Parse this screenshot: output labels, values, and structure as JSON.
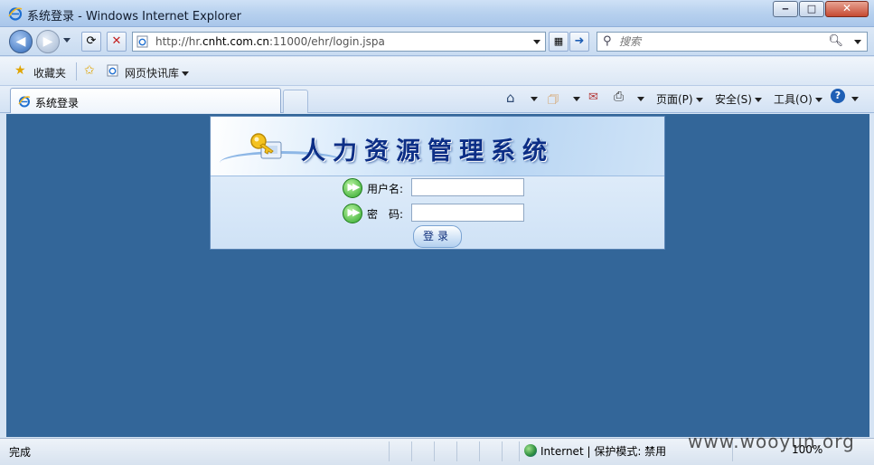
{
  "window": {
    "title": "系统登录 - Windows Internet Explorer",
    "minimize": "‒",
    "maximize": "□",
    "close": "✕"
  },
  "navbar": {
    "url_prefix": "http://hr.",
    "url_domain": "cnht.com.cn",
    "url_suffix": ":11000/ehr/login.jspa",
    "search_placeholder": "搜索"
  },
  "favorites": {
    "favorites_label": "收藏夹",
    "webslice_label": "网页快讯库"
  },
  "tabs": [
    {
      "label": "系统登录"
    }
  ],
  "commandbar": {
    "page_menu": "页面(P)",
    "safety_menu": "安全(S)",
    "tools_menu": "工具(O)"
  },
  "login": {
    "system_title": "人力资源管理系统",
    "username_label": "用户名:",
    "password_label": "密　码:",
    "username_value": "",
    "password_value": "",
    "submit_label": "登录"
  },
  "status": {
    "text": "完成",
    "zone": "Internet | 保护模式: 禁用",
    "zoom": "100%"
  },
  "watermark": "www.wooyun.org",
  "colors": {
    "page_background": "#336699",
    "title_text": "#0c2e86"
  }
}
